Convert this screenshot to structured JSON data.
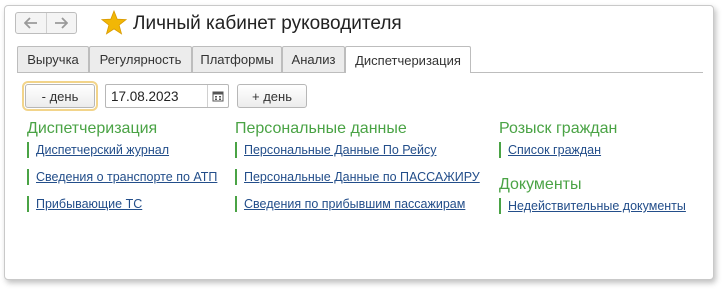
{
  "header": {
    "back_icon": "arrow-left-icon",
    "forward_icon": "arrow-right-icon",
    "favorite_icon": "star-icon",
    "favorite_color": "#f2b705",
    "title": "Личный кабинет руководителя"
  },
  "tabs": [
    {
      "label": "Выручка",
      "active": false
    },
    {
      "label": "Регулярность",
      "active": false
    },
    {
      "label": "Платформы",
      "active": false
    },
    {
      "label": "Анализ",
      "active": false
    },
    {
      "label": "Диспетчеризация",
      "active": true
    }
  ],
  "controls": {
    "prev_day_label": "- день",
    "date_value": "17.08.2023",
    "calendar_icon": "calendar-icon",
    "next_day_label": "+ день"
  },
  "sections": {
    "dispatch": {
      "title": "Диспетчеризация",
      "links": [
        "Диспетчерский журнал",
        "Сведения о транспорте по АТП",
        "Прибывающие ТС"
      ]
    },
    "personal": {
      "title": "Персональные данные",
      "links": [
        "Персональные Данные По Рейсу",
        "Персональные Данные по ПАССАЖИРУ",
        "Сведения по прибывшим пассажирам"
      ]
    },
    "search": {
      "title": "Розыск граждан",
      "links": [
        "Список граждан"
      ]
    },
    "documents": {
      "title": "Документы",
      "links": [
        "Недействительные документы"
      ]
    }
  },
  "colors": {
    "accent_green": "#4aa345",
    "link_blue": "#234e8a"
  }
}
